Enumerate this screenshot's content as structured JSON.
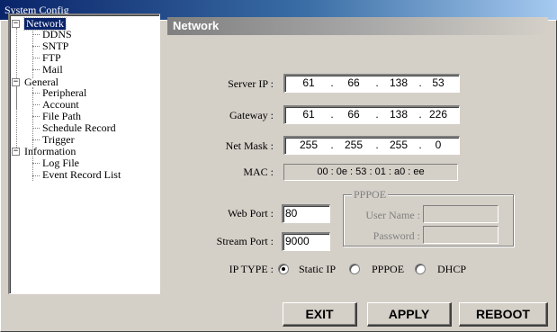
{
  "window": {
    "title": "System Config"
  },
  "tree": {
    "groups": [
      {
        "label": "Network",
        "toggle": "−",
        "selected": true,
        "children": [
          "DDNS",
          "SNTP",
          "FTP",
          "Mail"
        ]
      },
      {
        "label": "General",
        "toggle": "−",
        "selected": false,
        "children": [
          "Peripheral",
          "Account",
          "File Path",
          "Schedule Record",
          "Trigger"
        ]
      },
      {
        "label": "Information",
        "toggle": "−",
        "selected": false,
        "children": [
          "Log File",
          "Event Record List"
        ]
      }
    ]
  },
  "panel": {
    "title": "Network",
    "server_ip": {
      "label": "Server IP :",
      "octets": [
        "61",
        "66",
        "138",
        "53"
      ]
    },
    "gateway": {
      "label": "Gateway :",
      "octets": [
        "61",
        "66",
        "138",
        "226"
      ]
    },
    "netmask": {
      "label": "Net Mask :",
      "octets": [
        "255",
        "255",
        "255",
        "0"
      ]
    },
    "ip_separator": ".",
    "mac": {
      "label": "MAC :",
      "value": "00 : 0e : 53 : 01 : a0 : ee"
    },
    "web_port": {
      "label": "Web Port :",
      "value": "80"
    },
    "stream_port": {
      "label": "Stream Port :",
      "value": "9000"
    },
    "pppoe": {
      "title": "PPPOE",
      "username_label": "User Name :",
      "username_value": "",
      "password_label": "Password :",
      "password_value": ""
    },
    "ip_type": {
      "label": "IP TYPE :",
      "options": [
        "Static IP",
        "PPPOE",
        "DHCP"
      ],
      "selected": "Static IP"
    }
  },
  "buttons": {
    "exit": "EXIT",
    "apply": "APPLY",
    "reboot": "REBOOT"
  }
}
